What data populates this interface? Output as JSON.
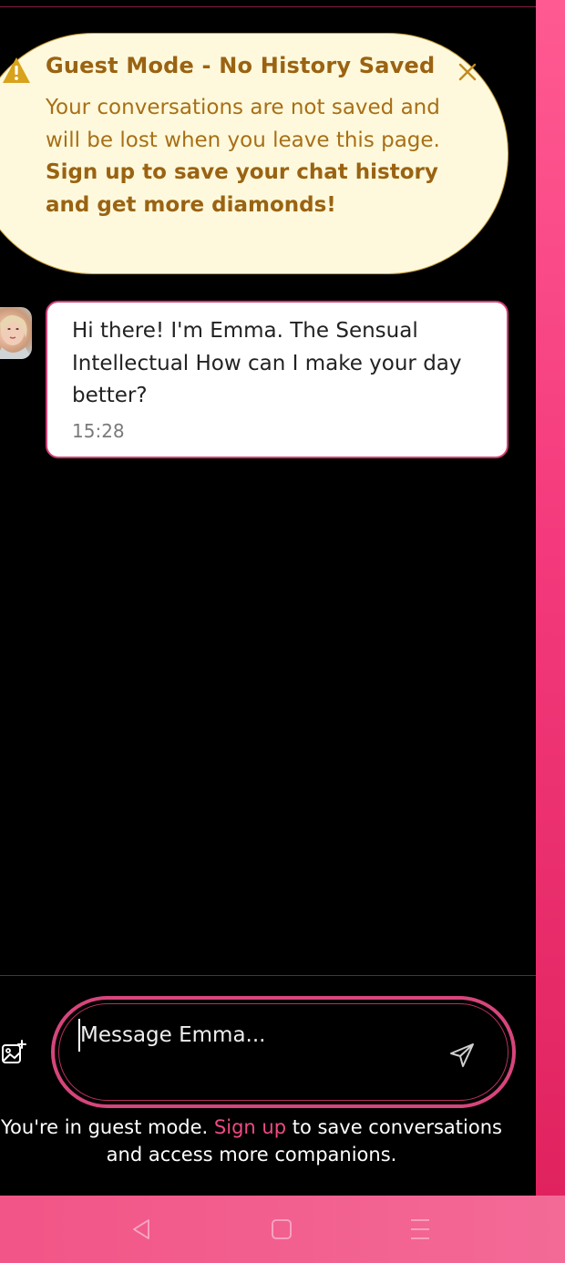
{
  "banner": {
    "title": "Guest Mode - No History Saved",
    "body_plain": "Your conversations are not saved and will be lost when you leave this page.",
    "body_bold": "Sign up to save your chat history and get more diamonds!",
    "warn_icon": "warning-triangle-icon",
    "close_icon": "close-icon",
    "color_bg": "#fef9dc",
    "color_text": "#9a6312"
  },
  "message": {
    "text": "Hi there! I'm Emma. The Sensual Intellectual How can I make your day better?",
    "time": "15:28",
    "avatar_icon": "emma-avatar"
  },
  "composer": {
    "placeholder": "Message Emma...",
    "attach_icon": "image-add-icon",
    "send_icon": "send-icon",
    "accent": "#d6457b"
  },
  "guest_note": {
    "prefix": "You're in guest mode.",
    "link": "Sign up",
    "suffix": "to save conversations and access more companions."
  },
  "navbar": {
    "back_icon": "back-triangle-icon",
    "home_icon": "home-square-icon",
    "menu_icon": "menu-lines-icon"
  }
}
